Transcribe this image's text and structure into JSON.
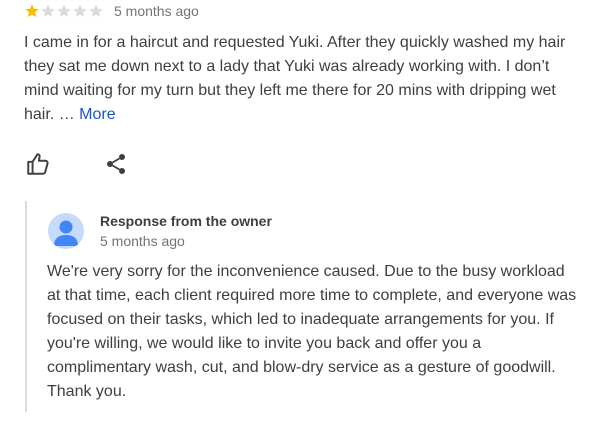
{
  "review": {
    "rating": 1,
    "max_rating": 5,
    "star_filled_color": "#fbbc04",
    "star_empty_color": "#dadce0",
    "timestamp": "5 months ago",
    "text": "I came in for a haircut and requested Yuki. After they quickly washed my hair they sat me down next to a lady that Yuki was already working with. I don’t mind waiting for my turn but they left me there for 20 mins with dripping wet hair. …",
    "more_label": "More",
    "more_color": "#1a56c8"
  },
  "actions": {
    "like_icon": "thumbs-up-icon",
    "share_icon": "share-icon"
  },
  "owner_response": {
    "title": "Response from the owner",
    "timestamp": "5 months ago",
    "text": "We're very sorry for the inconvenience caused. Due to the busy workload at that time, each client required more time to complete, and everyone was focused on their tasks, which led to inadequate arrangements for you. If you're willing, we would like to invite you back and offer you a complimentary wash, cut, and blow-dry service as a gesture of goodwill. Thank you.",
    "avatar_icon": "person-avatar-icon",
    "avatar_bg": "#c6dafc",
    "avatar_fg": "#4285f4"
  }
}
